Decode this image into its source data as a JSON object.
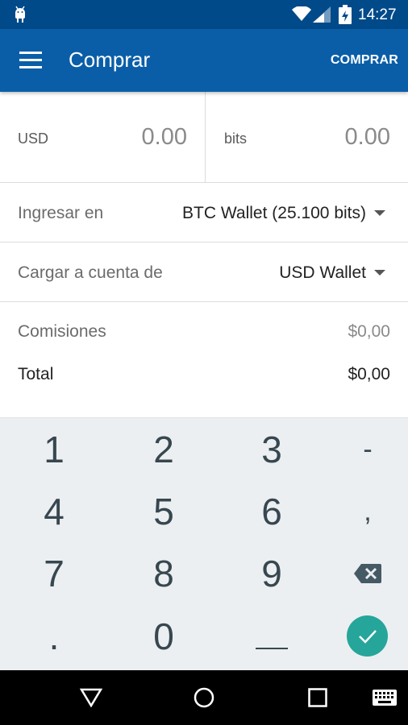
{
  "status_bar": {
    "time": "14:27",
    "icons": [
      "android-debug-icon",
      "wifi-icon",
      "signal-icon",
      "battery-charging-icon"
    ]
  },
  "app_bar": {
    "title": "Comprar",
    "action_label": "COMPRAR",
    "menu_icon": "hamburger-menu-icon"
  },
  "amounts": {
    "left": {
      "currency": "USD",
      "value": "0.00"
    },
    "right": {
      "currency": "bits",
      "value": "0.00"
    }
  },
  "deposit": {
    "label": "Ingresar en",
    "value": "BTC Wallet (25.100 bits)"
  },
  "charge": {
    "label": "Cargar a cuenta de",
    "value": "USD Wallet"
  },
  "fees": {
    "commission_label": "Comisiones",
    "commission_value": "$0,00",
    "total_label": "Total",
    "total_value": "$0,00"
  },
  "keypad": {
    "keys": [
      "1",
      "2",
      "3",
      "-",
      "4",
      "5",
      "6",
      ",",
      "7",
      "8",
      "9",
      "⌫",
      ".",
      "0",
      "_"
    ],
    "delete_icon": "backspace-icon",
    "confirm_icon": "check-icon"
  },
  "colors": {
    "status_bar": "#004a8a",
    "app_bar": "#0a5ea8",
    "keypad_bg": "#eceff1",
    "confirm": "#26a69a"
  },
  "nav_bar": {
    "icons": [
      "back-icon",
      "home-icon",
      "recents-icon",
      "keyboard-icon"
    ]
  }
}
